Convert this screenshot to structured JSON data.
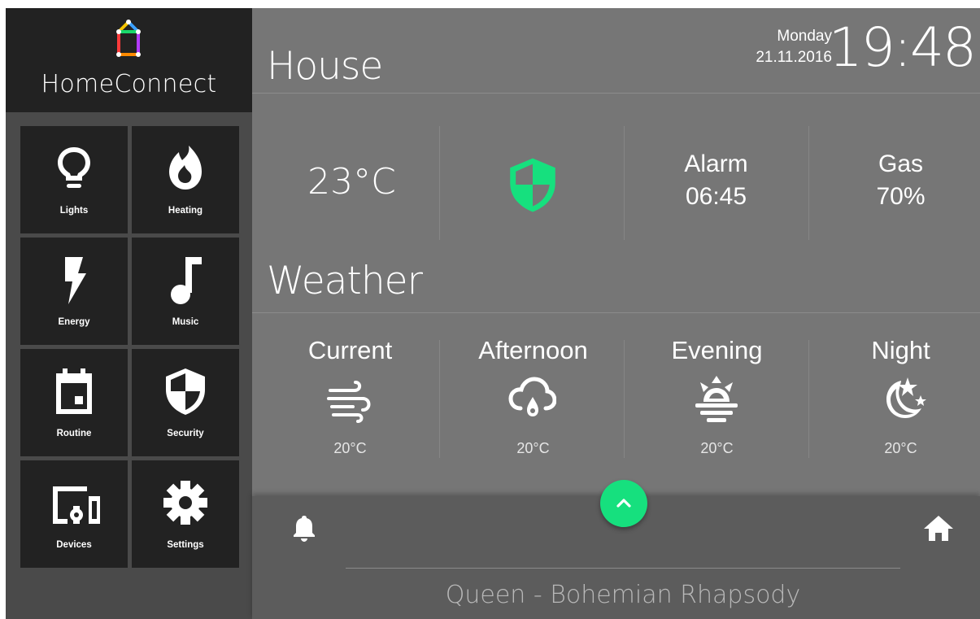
{
  "app": {
    "name": "HomeConnect"
  },
  "nav": {
    "tiles": [
      {
        "label": "Lights",
        "icon": "lightbulb-icon"
      },
      {
        "label": "Heating",
        "icon": "flame-icon"
      },
      {
        "label": "Energy",
        "icon": "lightning-bolt-icon"
      },
      {
        "label": "Music",
        "icon": "music-note-icon"
      },
      {
        "label": "Routine",
        "icon": "calendar-icon"
      },
      {
        "label": "Security",
        "icon": "shield-icon"
      },
      {
        "label": "Devices",
        "icon": "devices-icon"
      },
      {
        "label": "Settings",
        "icon": "gear-icon"
      }
    ]
  },
  "header": {
    "day": "Monday",
    "date": "21.11.2016",
    "time": "19:48"
  },
  "house": {
    "title": "House",
    "temperature": "23°C",
    "security_icon": "shield-icon",
    "security_color": "#16e07e",
    "alarm_label": "Alarm",
    "alarm_time": "06:45",
    "gas_label": "Gas",
    "gas_value": "70%"
  },
  "weather": {
    "title": "Weather",
    "slots": [
      {
        "name": "Current",
        "icon": "wind-icon",
        "temp": "20°C"
      },
      {
        "name": "Afternoon",
        "icon": "rain-cloud-icon",
        "temp": "20°C"
      },
      {
        "name": "Evening",
        "icon": "sunset-icon",
        "temp": "20°C"
      },
      {
        "name": "Night",
        "icon": "moon-stars-icon",
        "temp": "20°C"
      }
    ]
  },
  "footer": {
    "now_playing": "Queen - Bohemian Rhapsody",
    "accent": "#16e07e"
  }
}
